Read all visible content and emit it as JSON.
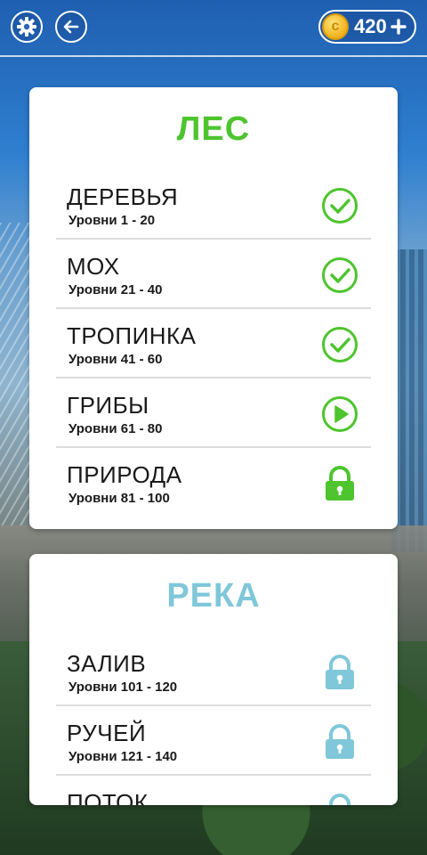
{
  "header": {
    "coins": "420",
    "coin_symbol": "c"
  },
  "sections": [
    {
      "title": "ЛЕС",
      "color": "#4ec42e",
      "levels": [
        {
          "name": "ДЕРЕВЬЯ",
          "range": "Уровни 1 - 20",
          "status": "completed"
        },
        {
          "name": "МОХ",
          "range": "Уровни 21 - 40",
          "status": "completed"
        },
        {
          "name": "ТРОПИНКА",
          "range": "Уровни 41 - 60",
          "status": "completed"
        },
        {
          "name": "ГРИБЫ",
          "range": "Уровни 61 - 80",
          "status": "play"
        },
        {
          "name": "ПРИРОДА",
          "range": "Уровни 81 - 100",
          "status": "locked"
        }
      ]
    },
    {
      "title": "РЕКА",
      "color": "#7fc7d9",
      "levels": [
        {
          "name": "ЗАЛИВ",
          "range": "Уровни 101 - 120",
          "status": "locked"
        },
        {
          "name": "РУЧЕЙ",
          "range": "Уровни 121 - 140",
          "status": "locked"
        },
        {
          "name": "ПОТОК",
          "status": "locked"
        }
      ]
    }
  ],
  "icons": {
    "settings": "gear-icon",
    "back": "arrow-left-icon",
    "add_coins": "plus-icon",
    "completed": "check-circle-icon",
    "play": "play-circle-icon",
    "locked": "lock-icon"
  }
}
